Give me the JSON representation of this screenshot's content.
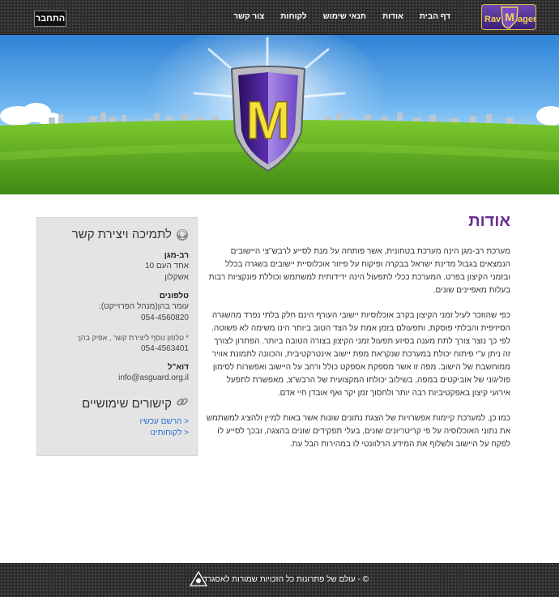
{
  "header": {
    "login_label": "התחבר",
    "logo": {
      "left_word": "Rav",
      "letter": "M",
      "right_word": "agen"
    },
    "nav": [
      {
        "label": "דף הבית"
      },
      {
        "label": "אודות"
      },
      {
        "label": "תנאי שימוש"
      },
      {
        "label": "לקוחות"
      },
      {
        "label": "צור קשר"
      }
    ]
  },
  "hero": {
    "shield_letter": "M"
  },
  "content": {
    "title": "אודות",
    "paragraphs": [
      "מערכת רב-מגן הינה מערכת בטחונית, אשר פותחה על מנת לסייע לרבש\"צי היישובים הנמצאים בגבול מדינת ישראל בבקרה ופיקוח על פיזור אוכלוסיית יישובים בשגרה בכלל ובזמני הקיצון בפרט. המערכת ככלי לתפעול הינה ידידותית למשתמש וכוללת פונקציות רבות בעלות מאפיינים שונים.",
      "כפי שהוזכר לעיל זמני הקיצון בקרב אוכלוסיות יישובי העורף הינם חלק בלתי נפרד מהשגרה הסיזיפית והבלתי פוסקת, ותפעולם בזמן אמת על הצד הטוב ביותר הינו משימה לא פשוטה.\nלפי כך נוצר צורך לתת מענה בסיוע תפעול זמני הקיצון בצורה הטובה ביותר. הפתרון לצורך זה ניתן ע\"י פיתוח יכולת במערכת שנקראת מפת יישוב אינטרקטיבית, והכוונה לתמונת אוויר ממוחשבת של הישוב. מפה זו אשר מספקת אספקט כולל ורחב על היישוב ואפשרות לסימון פוליגוני של אוביקטים במפה, בשילוב יכולתו המקצועית של הרבש\"צ, מאפשרת לתפעל אירועי קיצון באפקטיביות רבה יותר ולחסוך זמן יקר ואף אובדן חיי אדם.",
      "כמו כן, למערכת קיימות אפשרויות של הצגת נתונים שונות אשר באות למיין ולהציג למשתמש את נתוני האוכלוסיה על פי קריטריונים שונים, בעלי תפקידים שונים בהצגה, ובכך לסייע לו לפקח על היישוב ולשלוף את המידע הרלוונטי לו במהירות הבל עת."
    ]
  },
  "sidebar": {
    "support_heading": "לתמיכה ויצירת קשר",
    "org_name": "רב-מגן",
    "address_line1": "אחד העם 10",
    "address_line2": "אשקלון",
    "phones_label": "טלפונים",
    "phone_contact": "עומר בהן(מנהל הפרוייקט):",
    "phone_number": "054-4560820",
    "extra_note": "* טלפון נוסף ליצירת קשר , אפיק בהן:",
    "extra_number": "054-4563401",
    "email_label": "דוא\"ל",
    "email": "info@asguard.org.il",
    "links_heading": "קישורים שימושיים",
    "links": [
      {
        "label": "< הרשם עכשיו"
      },
      {
        "label": "< לקוחותינו"
      }
    ]
  },
  "footer": {
    "text": "© - עולם של פתרונות כל הזכויות שמורות לאסגרד"
  },
  "colors": {
    "accent_purple": "#6a2c91",
    "link_blue": "#2a6fd1",
    "bar_dark": "#2b2b2b"
  }
}
